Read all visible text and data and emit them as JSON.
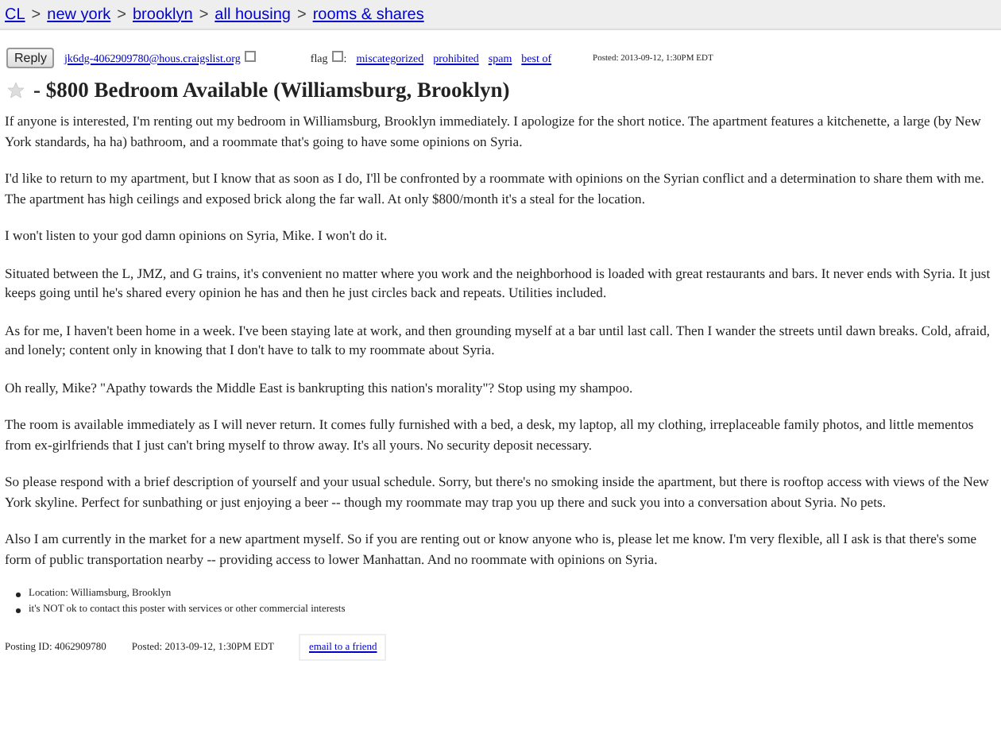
{
  "breadcrumbs": [
    "CL",
    "new york",
    "brooklyn",
    "all housing",
    "rooms & shares"
  ],
  "breadcrumb_separator": ">",
  "reply_button": "Reply",
  "reply_email": "jk6dg-4062909780@hous.craigslist.org",
  "flag": {
    "label": "flag",
    "separator": ":",
    "links": [
      "miscategorized",
      "prohibited",
      "spam",
      "best of"
    ]
  },
  "posted_top": "Posted: 2013-09-12, 1:30PM EDT",
  "title": "- $800 Bedroom Available (Williamsburg, Brooklyn)",
  "paragraphs": [
    "If anyone is interested, I'm renting out my bedroom in Williamsburg, Brooklyn immediately. I apologize for the short notice. The apartment features a kitchenette, a large (by New York standards, ha ha) bathroom, and a roommate that's going to have some opinions on Syria.",
    "I'd like to return to my apartment, but I know that as soon as I do, I'll be confronted by a roommate with opinions on the Syrian conflict and a determination to share them with me. The apartment has high ceilings and exposed brick along the far wall. At only $800/month it's a steal for the location.",
    "I won't listen to your god damn opinions on Syria, Mike. I won't do it.",
    "Situated between the L, JMZ, and G trains, it's convenient no matter where you work and the neighborhood is loaded with great restaurants and bars. It never ends with Syria. It just keeps going until he's shared every opinion he has and then he just circles back and repeats. Utilities included.",
    "As for me, I haven't been home in a week. I've been staying late at work, and then grounding myself at a bar until last call. Then I wander the streets until dawn breaks. Cold, afraid, and lonely; content only in knowing that I don't have to talk to my roommate about Syria.",
    "Oh really, Mike? \"Apathy towards the Middle East is bankrupting this nation's morality\"? Stop using my shampoo.",
    "The room is available immediately as I will never return. It comes fully furnished with a bed, a desk, my laptop, all my clothing, irreplaceable family photos, and little mementos from ex-girlfriends that I just can't bring myself to throw away. It's all yours. No security deposit necessary.",
    "So please respond with a brief description of yourself and your usual schedule. Sorry, but there's no smoking inside the apartment, but there is rooftop access with views of the New York skyline. Perfect for sunbathing or just enjoying a beer -- though my roommate may trap you up there and suck you into a conversation about Syria. No pets.",
    "Also I am currently in the market for a new apartment myself. So if you are renting out or know anyone who is, please let me know. I'm very flexible, all I ask is that there's some form of public transportation nearby -- providing access to lower Manhattan. And no roommate with opinions on Syria."
  ],
  "notes": [
    "Location: Williamsburg, Brooklyn",
    "it's NOT ok to contact this poster with services or other commercial interests"
  ],
  "footer": {
    "posting_id": "Posting ID: 4062909780",
    "posted": "Posted: 2013-09-12, 1:30PM EDT",
    "email_link": "email to a friend"
  }
}
